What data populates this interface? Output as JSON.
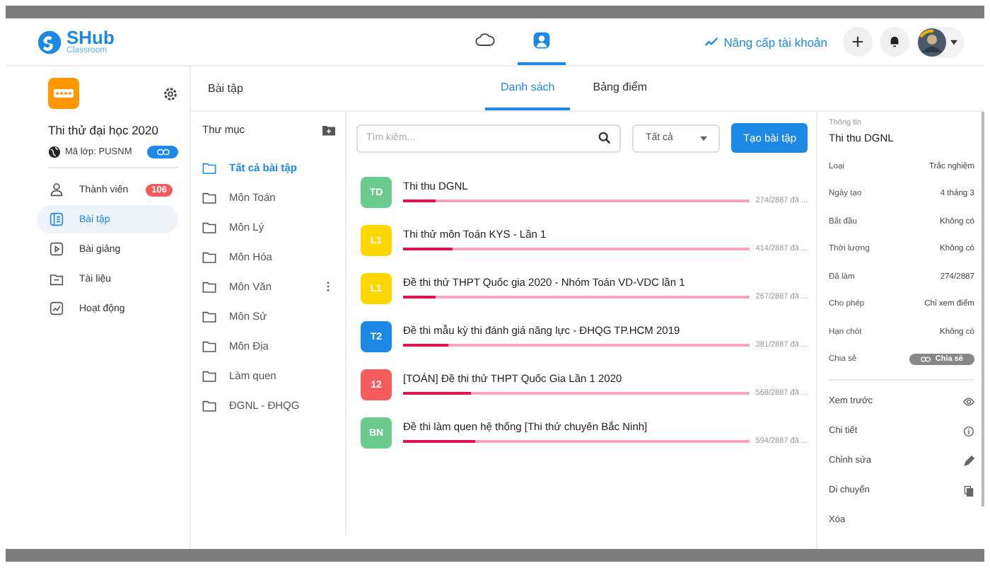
{
  "header": {
    "logo": {
      "name": "SHub",
      "tagline": "Classroom"
    },
    "nav_tabs": [
      {
        "kind": "cloud",
        "selected": false
      },
      {
        "kind": "user",
        "selected": true
      }
    ],
    "upgrade_link": "Nâng cấp tài khoản"
  },
  "sidebar": {
    "class_name": "Thi thử đại học 2020",
    "class_code": "Mã lớp: PUSNM",
    "code_toggle_on": true,
    "items": [
      {
        "kind": "members",
        "label": "Thành viên",
        "badge": "106",
        "selected": false
      },
      {
        "kind": "assignments",
        "label": "Bài tập",
        "selected": true
      },
      {
        "kind": "lectures",
        "label": "Bài giảng",
        "selected": false
      },
      {
        "kind": "documents",
        "label": "Tài liệu",
        "selected": false
      },
      {
        "kind": "activity",
        "label": "Hoạt động",
        "selected": false
      }
    ]
  },
  "page_title": "Bài tập",
  "tabs": [
    {
      "label": "Danh sách",
      "selected": true
    },
    {
      "label": "Bảng điểm",
      "selected": false
    }
  ],
  "folders": {
    "title": "Thư mục",
    "items": [
      {
        "label": "Tất cả bài tập",
        "selected": true,
        "menu": false
      },
      {
        "label": "Môn Toán",
        "selected": false,
        "menu": false
      },
      {
        "label": "Môn Lý",
        "selected": false,
        "menu": false
      },
      {
        "label": "Môn Hóa",
        "selected": false,
        "menu": false
      },
      {
        "label": "Môn Văn",
        "selected": false,
        "menu": true
      },
      {
        "label": "Môn Sử",
        "selected": false,
        "menu": false
      },
      {
        "label": "Môn Địa",
        "selected": false,
        "menu": false
      },
      {
        "label": "Làm quen",
        "selected": false,
        "menu": false
      },
      {
        "label": "ĐGNL - ĐHQG",
        "selected": false,
        "menu": false
      }
    ]
  },
  "search": {
    "placeholder": "Tìm kiếm..."
  },
  "filter": "Tất cả",
  "create_button": "Tạo bài tập",
  "assignments": [
    {
      "tag": "TD",
      "color": "#6acb8c",
      "title": "Thi thu DGNL",
      "level": 0.095,
      "reading": "274/2887 đã ..."
    },
    {
      "tag": "L1",
      "color": "#ffd600",
      "title": "Thi thử môn Toán KYS - Lần 1",
      "level": 0.143,
      "reading": "414/2887 đã ..."
    },
    {
      "tag": "L1",
      "color": "#ffd600",
      "title": "Đề thi thử THPT Quốc gia 2020 - Nhóm Toán VD-VDC lần 1",
      "level": 0.092,
      "reading": "267/2887 đã ..."
    },
    {
      "tag": "T2",
      "color": "#1e88e5",
      "title": "Đề thi mẫu kỳ thi đánh giá năng lực - ĐHQG TP.HCM 2019",
      "level": 0.132,
      "reading": "381/2887 đã ..."
    },
    {
      "tag": "12",
      "color": "#f45b5b",
      "title": "[TOÁN] Đề thi thử THPT Quốc Gia Lần 1 2020",
      "level": 0.197,
      "reading": "568/2887 đã ..."
    },
    {
      "tag": "BN",
      "color": "#6acb8c",
      "title": "Đề thi làm quen hệ thống [Thi thử chuyên Bắc Ninh]",
      "level": 0.206,
      "reading": "594/2887 đã ..."
    }
  ],
  "info": {
    "heading": "Thông tin",
    "title": "Thi thu DGNL",
    "fields": [
      {
        "label": "Loại",
        "value": "Trắc nghiệm"
      },
      {
        "label": "Ngày tạo",
        "value": "4 tháng 3"
      },
      {
        "label": "Bắt đầu",
        "value": "Không có"
      },
      {
        "label": "Thời lượng",
        "value": "Không có"
      },
      {
        "label": "Đã làm",
        "value": "274/2887"
      },
      {
        "label": "Cho phép",
        "value": "Chỉ xem điểm"
      },
      {
        "label": "Hạn chót",
        "value": "Không có"
      }
    ],
    "share_label": "Chia sẻ",
    "share_button": "Chia sẻ",
    "actions": [
      {
        "kind": "preview",
        "label": "Xem trước"
      },
      {
        "kind": "details",
        "label": "Chi tiết"
      },
      {
        "kind": "edit",
        "label": "Chỉnh sửa"
      },
      {
        "kind": "move",
        "label": "Di chuyển"
      },
      {
        "kind": "delete",
        "label": "Xóa"
      }
    ]
  }
}
